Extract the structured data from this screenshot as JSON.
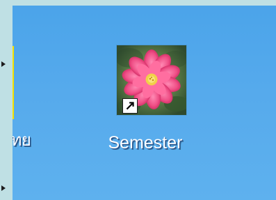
{
  "desktop": {
    "colors": {
      "background": "#5eb1ee",
      "left_strip": "#bfe0e4"
    },
    "icons": [
      {
        "label": "ไทย",
        "icon": "yellow-file-icon",
        "partial": true
      },
      {
        "label": "Semester",
        "icon": "pink-water-lily-icon",
        "shortcut": true
      }
    ]
  }
}
